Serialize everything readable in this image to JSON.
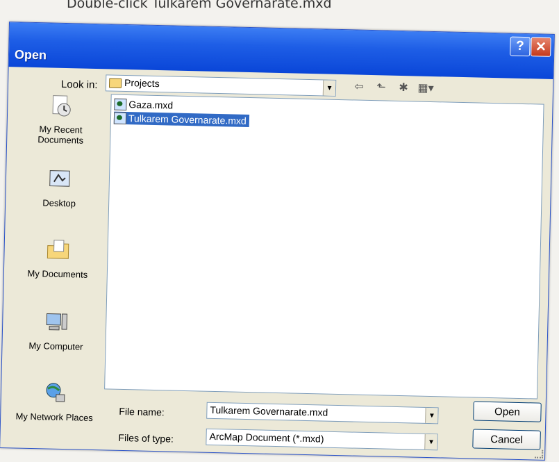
{
  "caption": "Double-click Tulkarem Governarate.mxd",
  "window": {
    "title": "Open",
    "help_label": "?",
    "close_label": "✕"
  },
  "look_in": {
    "label": "Look in:",
    "value": "Projects"
  },
  "toolbar": {
    "back_icon": "⇦",
    "up_icon": "⬑",
    "new_folder_icon": "✱",
    "views_icon": "▦▾"
  },
  "places": [
    {
      "label": "My Recent Documents",
      "icon": "recent-documents-icon"
    },
    {
      "label": "Desktop",
      "icon": "desktop-icon"
    },
    {
      "label": "My Documents",
      "icon": "my-documents-icon"
    },
    {
      "label": "My Computer",
      "icon": "my-computer-icon"
    },
    {
      "label": "My Network Places",
      "icon": "network-places-icon"
    }
  ],
  "files": [
    {
      "name": "Gaza.mxd",
      "selected": false
    },
    {
      "name": "Tulkarem Governarate.mxd",
      "selected": true
    }
  ],
  "file_name": {
    "label": "File name:",
    "value": "Tulkarem Governarate.mxd"
  },
  "files_of_type": {
    "label": "Files of type:",
    "value": "ArcMap Document (*.mxd)"
  },
  "buttons": {
    "open": "Open",
    "cancel": "Cancel"
  },
  "colors": {
    "titlebar": "#0a46d8",
    "selection": "#316ac5",
    "dialog_bg": "#ece9d8"
  }
}
